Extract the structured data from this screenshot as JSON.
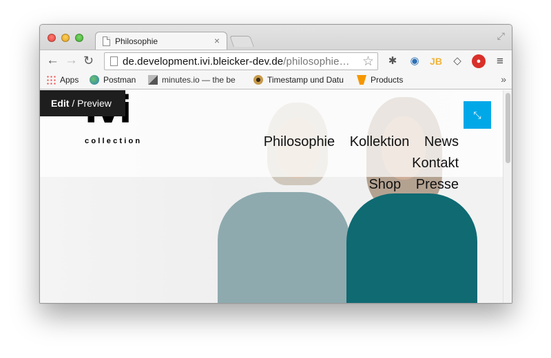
{
  "browser": {
    "tab_title": "Philosophie",
    "tab_close": "×",
    "url_host": "de.development.ivi.bleicker-dev.de",
    "url_path": "/philosophie…",
    "nav_back": "←",
    "nav_forward": "→",
    "nav_reload": "↻",
    "star": "☆",
    "ext_jb": "JB",
    "ext_stop": "●",
    "menu": "≡",
    "fullscreen": "⤢",
    "bookmarks": [
      {
        "label": "Apps",
        "icon": "apps-grid-icon"
      },
      {
        "label": "Postman",
        "icon": "postman-globe-icon"
      },
      {
        "label": "minutes.io — the be",
        "icon": "minutes-icon"
      },
      {
        "label": "Timestamp und Datu",
        "icon": "timestamp-icon"
      },
      {
        "label": "Products",
        "icon": "typo3-icon"
      }
    ],
    "bookmarks_more": "»"
  },
  "site": {
    "logo_main": "ivi",
    "logo_sub": "collection",
    "nav_row1": [
      "Philosophie",
      "Kollektion",
      "News",
      "Kontakt"
    ],
    "nav_row2": [
      "Shop",
      "Presse"
    ],
    "edit_label": "Edit",
    "edit_sep": " / ",
    "preview_label": "Preview",
    "collapse_icon": "⤡"
  },
  "colors": {
    "accent": "#00a8e8",
    "edit_bar": "#1e1e1e",
    "traffic_close": "#e0443a",
    "traffic_min": "#dfa123",
    "traffic_max": "#3fae2f"
  }
}
